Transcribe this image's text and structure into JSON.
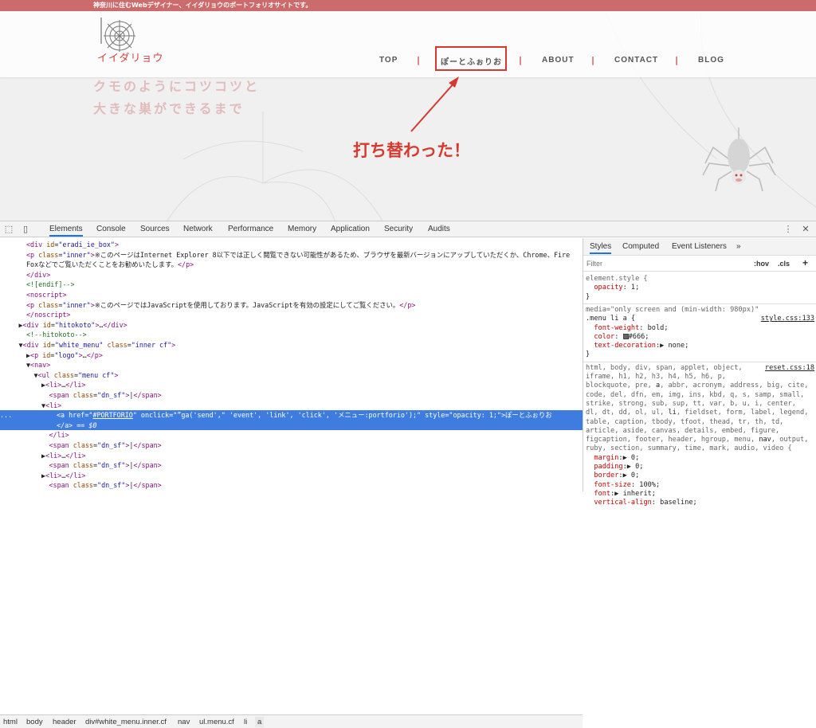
{
  "site": {
    "topbar_text": "神奈川に住むWebデザイナー、イイダリョウのポートフォリオサイトです。",
    "logo_text": "イイダリョウ",
    "nav": [
      "TOP",
      "ぽーとふぉりお",
      "ABOUT",
      "CONTACT",
      "BLOG"
    ],
    "separator": "|",
    "hero_line1": "クモのようにコツコツと",
    "hero_line2": "大きな巣ができるまで",
    "annotation": "打ち替わった！"
  },
  "devtools": {
    "tabs": [
      "Elements",
      "Console",
      "Sources",
      "Network",
      "Performance",
      "Memory",
      "Application",
      "Security",
      "Audits"
    ],
    "active_tab": "Elements",
    "dom_lines": [
      {
        "indent": 4,
        "html": "<span class='tag'>&lt;div</span> <span class='attr'>id</span>=<span class='val'>\"eradi_ie_box\"</span><span class='tag'>&gt;</span>"
      },
      {
        "indent": 4,
        "html": "<span class='tag'>&lt;p</span> <span class='attr'>class</span>=<span class='val'>\"inner\"</span><span class='tag'>&gt;</span>※このページはInternet Explorer 8以下では正しく閲覧できない可能性があるため、ブラウザを最新バージョンにアップしていただくか、Chrome、Fire"
      },
      {
        "indent": 4,
        "html": "Foxなどでご覧いただくことをお勧めいたします。<span class='tag'>&lt;/p&gt;</span>"
      },
      {
        "indent": 4,
        "html": "<span class='tag'>&lt;/div&gt;</span>"
      },
      {
        "indent": 4,
        "html": "<span class='cmt'>&lt;![endif]--&gt;</span>"
      },
      {
        "indent": 4,
        "html": "<span class='tag'>&lt;noscript&gt;</span>"
      },
      {
        "indent": 4,
        "html": "<span class='tag'>&lt;p</span> <span class='attr'>class</span>=<span class='val'>\"inner\"</span><span class='tag'>&gt;</span>※このページではJavaScriptを使用しております。JavaScriptを有効の設定にしてご覧ください。<span class='tag'>&lt;/p&gt;</span>"
      },
      {
        "indent": 4,
        "html": "<span class='tag'>&lt;/noscript&gt;</span>"
      },
      {
        "indent": 3,
        "html": "▶<span class='tag'>&lt;div</span> <span class='attr'>id</span>=<span class='val'>\"hitokoto\"</span><span class='tag'>&gt;</span>…<span class='tag'>&lt;/div&gt;</span>"
      },
      {
        "indent": 4,
        "html": "<span class='cmt'>&lt;!--hitokoto--&gt;</span>"
      },
      {
        "indent": 3,
        "html": "▼<span class='tag'>&lt;div</span> <span class='attr'>id</span>=<span class='val'>\"white_menu\"</span> <span class='attr'>class</span>=<span class='val'>\"inner cf\"</span><span class='tag'>&gt;</span>"
      },
      {
        "indent": 4,
        "html": "▶<span class='tag'>&lt;p</span> <span class='attr'>id</span>=<span class='val'>\"logo\"</span><span class='tag'>&gt;</span>…<span class='tag'>&lt;/p&gt;</span>"
      },
      {
        "indent": 4,
        "html": "▼<span class='tag'>&lt;nav&gt;</span>"
      },
      {
        "indent": 5,
        "html": "▼<span class='tag'>&lt;ul</span> <span class='attr'>class</span>=<span class='val'>\"menu cf\"</span><span class='tag'>&gt;</span>"
      },
      {
        "indent": 6,
        "html": "▶<span class='tag'>&lt;li&gt;</span>…<span class='tag'>&lt;/li&gt;</span>"
      },
      {
        "indent": 7,
        "html": "<span class='tag'>&lt;span</span> <span class='attr'>class</span>=<span class='val'>\"dn_sf\"</span><span class='tag'>&gt;</span>|<span class='tag'>&lt;/span&gt;</span>"
      },
      {
        "indent": 6,
        "html": "▼<span class='tag'>&lt;li&gt;</span>"
      },
      {
        "indent": 8,
        "sel": true,
        "prefix": "...",
        "html": "<span class='tag'>&lt;a</span> <span class='attr'>href</span>=<span class='val'>\"<u>#PORTFORIO</u>\"</span> <span class='attr'>onclick</span>=<span class='val'>\"”ga('send',\" 'event', 'link', 'click', 'メニュー:portforio');\"</span> <span class='attr'>style</span>=<span class='val'>\"opacity: 1;\"</span><span class='tag'>&gt;</span>ぽーとふぉりお"
      },
      {
        "indent": 8,
        "sel": true,
        "html": "<span class='tag'>&lt;/a&gt;</span> == <i>$0</i>"
      },
      {
        "indent": 7,
        "html": "<span class='tag'>&lt;/li&gt;</span>"
      },
      {
        "indent": 7,
        "html": "<span class='tag'>&lt;span</span> <span class='attr'>class</span>=<span class='val'>\"dn_sf\"</span><span class='tag'>&gt;</span>|<span class='tag'>&lt;/span&gt;</span>"
      },
      {
        "indent": 6,
        "html": "▶<span class='tag'>&lt;li&gt;</span>…<span class='tag'>&lt;/li&gt;</span>"
      },
      {
        "indent": 7,
        "html": "<span class='tag'>&lt;span</span> <span class='attr'>class</span>=<span class='val'>\"dn_sf\"</span><span class='tag'>&gt;</span>|<span class='tag'>&lt;/span&gt;</span>"
      },
      {
        "indent": 6,
        "html": "▶<span class='tag'>&lt;li&gt;</span>…<span class='tag'>&lt;/li&gt;</span>"
      },
      {
        "indent": 7,
        "html": "<span class='tag'>&lt;span</span> <span class='attr'>class</span>=<span class='val'>\"dn_sf\"</span><span class='tag'>&gt;</span>|<span class='tag'>&lt;/span&gt;</span>"
      }
    ],
    "breadcrumb": [
      "html",
      "body",
      "header",
      "div#white_menu.inner.cf",
      "nav",
      "ul.menu.cf",
      "li",
      "a"
    ],
    "styles_tabs": [
      "Styles",
      "Computed",
      "Event Listeners",
      "»"
    ],
    "filter_placeholder": "Filter",
    "hov": ":hov",
    "cls": ".cls",
    "plus": "+",
    "style_lines": [
      {
        "html": "<span class='gray'>element.style {</span>"
      },
      {
        "html": "&nbsp;&nbsp;<span class='prop'>opacity</span>: 1;"
      },
      {
        "html": "}"
      },
      {
        "sep": true
      },
      {
        "html": "<span class='gray'>media=\"only screen and (min-width: 980px)\"</span>"
      },
      {
        "html": ".menu li a {",
        "src": "style.css:133"
      },
      {
        "html": "&nbsp;&nbsp;<span class='prop'>font-weight</span>: bold;"
      },
      {
        "html": "&nbsp;&nbsp;<span class='prop'>color</span>: <span style='display:inline-block;width:7px;height:7px;background:#666;border:1px solid #444;vertical-align:middle'></span>#666;"
      },
      {
        "html": "&nbsp;&nbsp;<span class='prop'>text-decoration</span>:▶ none;"
      },
      {
        "html": "}"
      },
      {
        "sep": true
      },
      {
        "html": "<span class='gray'>html, body, div, span, applet, object,</span>",
        "src": "reset.css:18"
      },
      {
        "html": "<span class='gray'>iframe, h1, h2, h3, h4, h5, h6, p,</span>"
      },
      {
        "html": "<span class='gray'>blockquote, pre, </span>a<span class='gray'>, abbr, acronym, address, big, cite,</span>"
      },
      {
        "html": "<span class='gray'>code, del, dfn, em, img, ins, kbd, q, s, samp, small,</span>"
      },
      {
        "html": "<span class='gray'>strike, strong, sub, sup, tt, var, b, u, i, center,</span>"
      },
      {
        "html": "<span class='gray'>dl, dt, dd, ol, ul, </span>li<span class='gray'>, fieldset, form, label, legend,</span>"
      },
      {
        "html": "<span class='gray'>table, caption, tbody, tfoot, thead, tr, th, td,</span>"
      },
      {
        "html": "<span class='gray'>article, aside, canvas, details, embed, figure,</span>"
      },
      {
        "html": "<span class='gray'>figcaption, footer, header, hgroup, menu, </span>nav<span class='gray'>, output,</span>"
      },
      {
        "html": "<span class='gray'>ruby, section, summary, time, mark, audio, video {</span>"
      },
      {
        "html": "&nbsp;&nbsp;<span class='prop'>margin</span>:▶ 0;"
      },
      {
        "html": "&nbsp;&nbsp;<span class='prop'>padding</span>:▶ 0;"
      },
      {
        "html": "&nbsp;&nbsp;<span class='prop'>border</span>:▶ 0;"
      },
      {
        "html": "&nbsp;&nbsp;<span class='prop'>font-size</span>: 100%;"
      },
      {
        "html": "&nbsp;&nbsp;<span class='prop'>font</span>:▶ inherit;"
      },
      {
        "html": "&nbsp;&nbsp;<span class='prop'>vertical-align</span>: baseline;"
      },
      {
        "html": "}"
      }
    ]
  }
}
